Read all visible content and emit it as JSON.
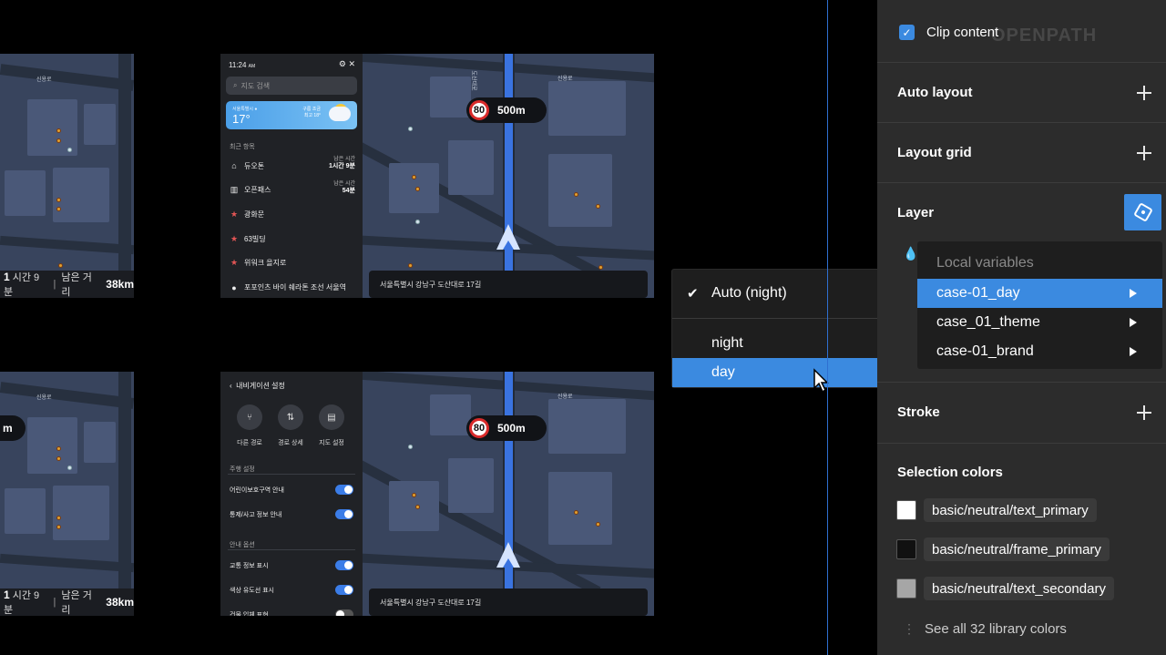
{
  "frames": {
    "left_top": {
      "trip": {
        "time_label": "시간",
        "time_value": "1",
        "time_unit": "시간 9분",
        "dist_label": "남은 거리",
        "dist_value": "38km"
      },
      "map_label": "신용로"
    },
    "left_bottom": {
      "trip": {
        "time_label": "시간",
        "time_value": "1",
        "time_unit": "시간 9분",
        "dist_label": "남은 거리",
        "dist_value": "38km"
      },
      "map_label": "신용로",
      "pill_text": "m"
    },
    "main_top": {
      "time": "11:24",
      "time_suffix": "AM",
      "icons": "⚙  ✕",
      "search_placeholder": "지도 검색",
      "weather": {
        "city": "서울특별시 ●",
        "temp": "17°",
        "info_line1": "구름 조금",
        "info_line2": "최고 18°"
      },
      "recent_title": "최근 항목",
      "recent": [
        {
          "icon": "⌂",
          "label": "듀오톤",
          "right1": "남은 시간",
          "right2": "1시간 9분"
        },
        {
          "icon": "▥",
          "label": "오픈패스",
          "right1": "남은 시간",
          "right2": "54분"
        },
        {
          "icon": "★",
          "label": "광화문",
          "right1": "",
          "right2": ""
        },
        {
          "icon": "★",
          "label": "63빌딩",
          "right1": "",
          "right2": ""
        },
        {
          "icon": "★",
          "label": "위워크 을지로",
          "right1": "",
          "right2": ""
        },
        {
          "icon": "●",
          "label": "포포인츠 바이 쉐라톤 조선 서울역",
          "right1": "",
          "right2": ""
        }
      ],
      "speed_limit": "80",
      "distance": "500m",
      "address": "서울특별시 강남구 도산대로 17길",
      "road_label": "도산대로",
      "map_label": "신용로"
    },
    "main_bottom": {
      "settings_title": "내비게이션 설정",
      "actions": [
        {
          "icon": "⑂",
          "label": "다른 경로"
        },
        {
          "icon": "⇅",
          "label": "경로 상세"
        },
        {
          "icon": "▤",
          "label": "지도 설정"
        }
      ],
      "section1": "주행 설정",
      "rows1": [
        {
          "label": "어린이보호구역 안내",
          "on": true
        },
        {
          "label": "통제/사고 정보 안내",
          "on": true
        }
      ],
      "section2": "안내 옵션",
      "rows2": [
        {
          "label": "교통 정보 표시",
          "on": true
        },
        {
          "label": "색상 유도선 표시",
          "on": true
        },
        {
          "label": "건물 입체 표현",
          "on": false
        }
      ],
      "speed_limit": "80",
      "distance": "500m",
      "address": "서울특별시 강남구 도산대로 17길",
      "map_label": "신용로"
    }
  },
  "mode_menu": {
    "items": [
      {
        "label": "Auto (night)",
        "checked": true,
        "selected": false
      },
      {
        "label": "night",
        "checked": false,
        "selected": false
      },
      {
        "label": "day",
        "checked": false,
        "selected": true
      }
    ],
    "check_glyph": "✔"
  },
  "variables_menu": {
    "header": "Local variables",
    "items": [
      {
        "label": "case-01_day",
        "selected": true
      },
      {
        "label": "case_01_theme",
        "selected": false
      },
      {
        "label": "case-01_brand",
        "selected": false
      }
    ]
  },
  "properties": {
    "clip_content": {
      "label": "Clip content",
      "checked": true,
      "check_glyph": "✓"
    },
    "watermark": "OPENPATH",
    "sections": {
      "auto_layout": "Auto layout",
      "layout_grid": "Layout grid",
      "layer": "Layer",
      "stroke": "Stroke",
      "selection_colors": "Selection colors"
    },
    "layer_icon": "💧",
    "colors": [
      {
        "swatch": "#ffffff",
        "token": "basic/neutral/text_primary"
      },
      {
        "swatch": "#111111",
        "token": "basic/neutral/frame_primary"
      },
      {
        "swatch": "#a6a6a6",
        "token": "basic/neutral/text_secondary"
      }
    ],
    "see_all": "See all 32 library colors",
    "see_all_icon": "⋮"
  },
  "colors": {
    "accent": "#3b8ae0",
    "route": "#3a73e0",
    "panel_bg": "#2c2c2c",
    "speed_ring": "#d92b2b"
  }
}
